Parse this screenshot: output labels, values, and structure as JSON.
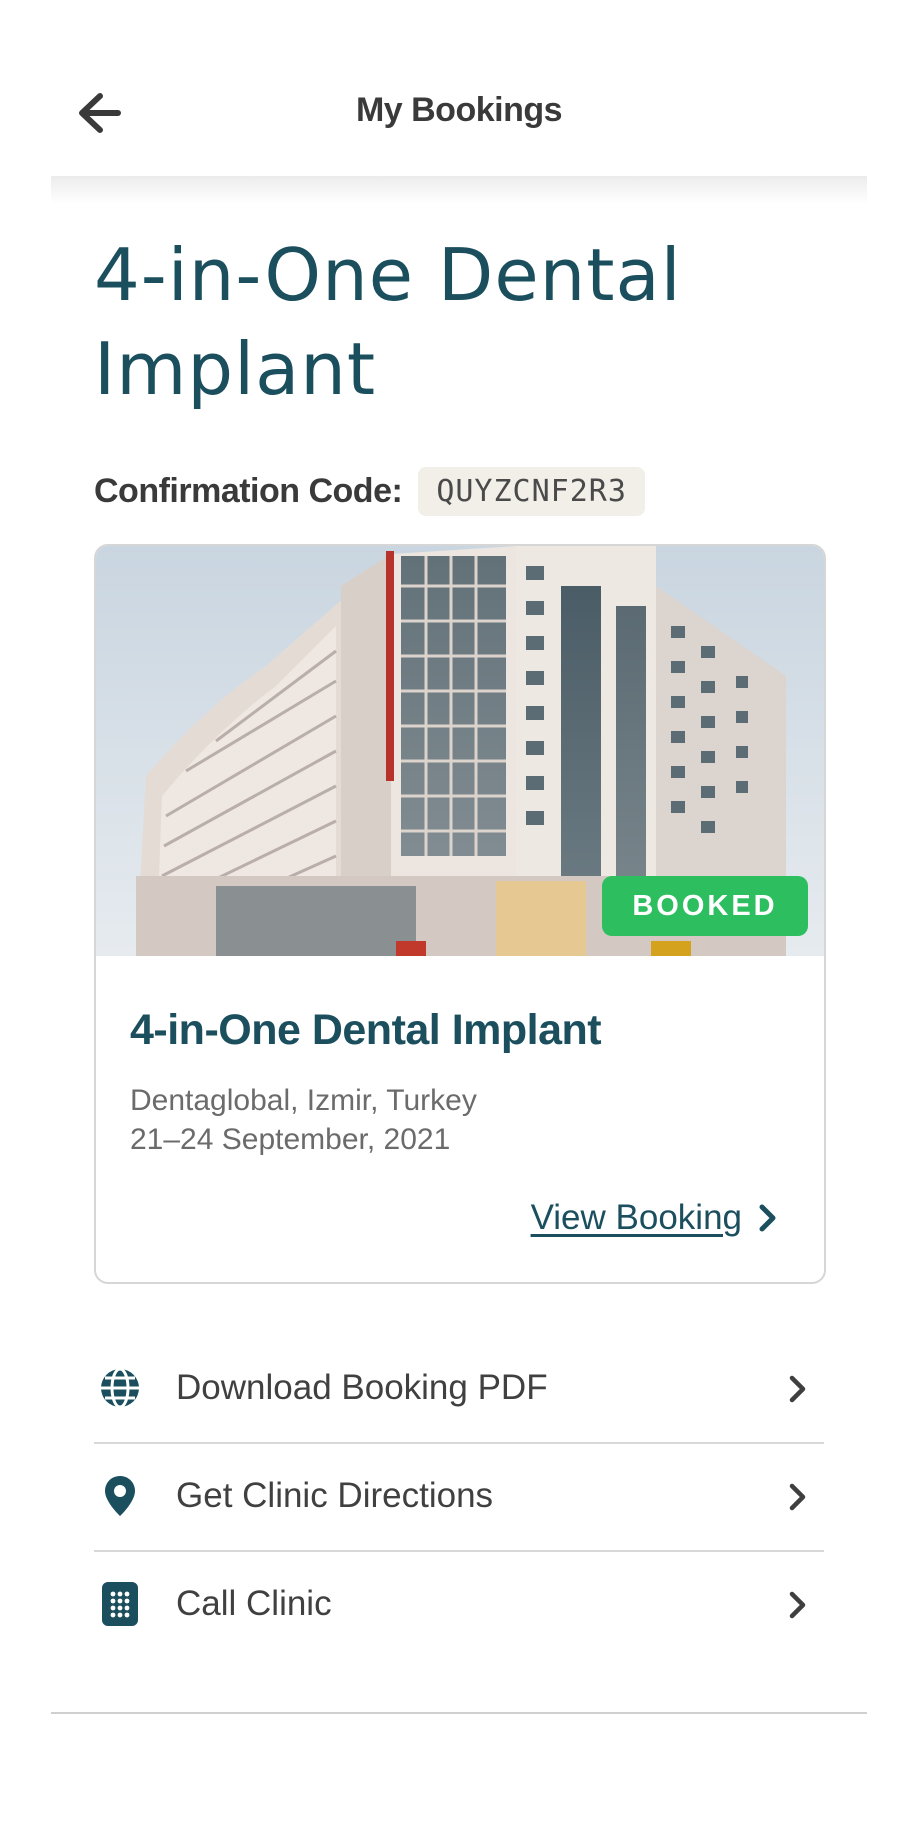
{
  "header": {
    "title": "My Bookings"
  },
  "booking": {
    "title": "4-in-One Dental Implant",
    "confirmation_label": "Confirmation Code:",
    "confirmation_code": "QUYZCNF2R3"
  },
  "card": {
    "status_badge": "BOOKED",
    "title": "4-in-One Dental Implant",
    "location": "Dentaglobal, Izmir, Turkey",
    "dates": "21–24 September, 2021",
    "link_label": "View Booking"
  },
  "actions": [
    {
      "label": "Download Booking PDF",
      "icon": "globe-icon"
    },
    {
      "label": "Get Clinic Directions",
      "icon": "map-pin-icon"
    },
    {
      "label": "Call Clinic",
      "icon": "phone-keypad-icon"
    }
  ],
  "colors": {
    "primary": "#1b4f5e",
    "status_green": "#2dbe60",
    "code_background": "#f2eee8"
  }
}
